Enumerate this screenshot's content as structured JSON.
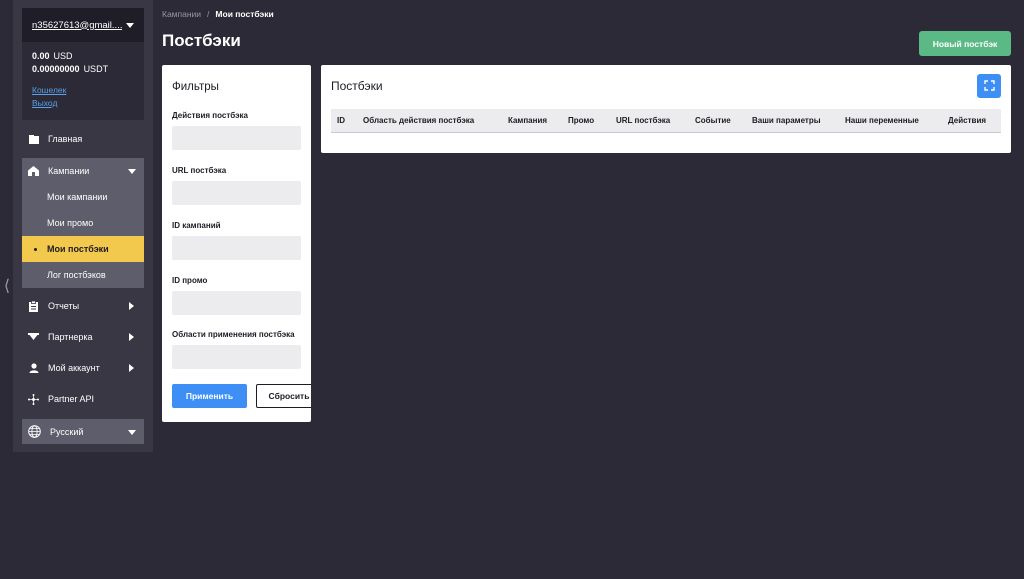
{
  "account": {
    "email": "n35627613@gmail....",
    "balances": [
      {
        "amount": "0.00",
        "currency": "USD"
      },
      {
        "amount": "0.00000000",
        "currency": "USDT"
      }
    ],
    "wallet_link": "Кошелек",
    "logout_link": "Выход"
  },
  "nav": {
    "home": "Главная",
    "campaigns": "Кампании",
    "campaigns_sub": [
      "Мои кампании",
      "Мои промо",
      "Мои постбэки",
      "Лог постбэков"
    ],
    "reports": "Отчеты",
    "partnership": "Партнерка",
    "my_account": "Мой аккаунт",
    "partner_api": "Partner API",
    "language": "Русский"
  },
  "breadcrumb": {
    "parent": "Кампании",
    "separator": "/",
    "current": "Мои постбэки"
  },
  "page": {
    "title": "Постбэки",
    "new_button": "Новый постбэк"
  },
  "filters": {
    "title": "Фильтры",
    "fields": [
      "Действия постбэка",
      "URL постбэка",
      "ID кампаний",
      "ID промо",
      "Области применения постбэка"
    ],
    "apply": "Применить",
    "reset": "Сбросить"
  },
  "table": {
    "title": "Постбэки",
    "columns": [
      "ID",
      "Область действия постбэка",
      "Кампания",
      "Промо",
      "URL постбэка",
      "Событие",
      "Ваши параметры",
      "Наши переменные",
      "Действия"
    ]
  },
  "colors": {
    "background": "#2b2a36",
    "sidebar": "#383743",
    "accent_yellow": "#f2c94c",
    "accent_green": "#5bb986",
    "accent_blue": "#3d8ff5"
  }
}
